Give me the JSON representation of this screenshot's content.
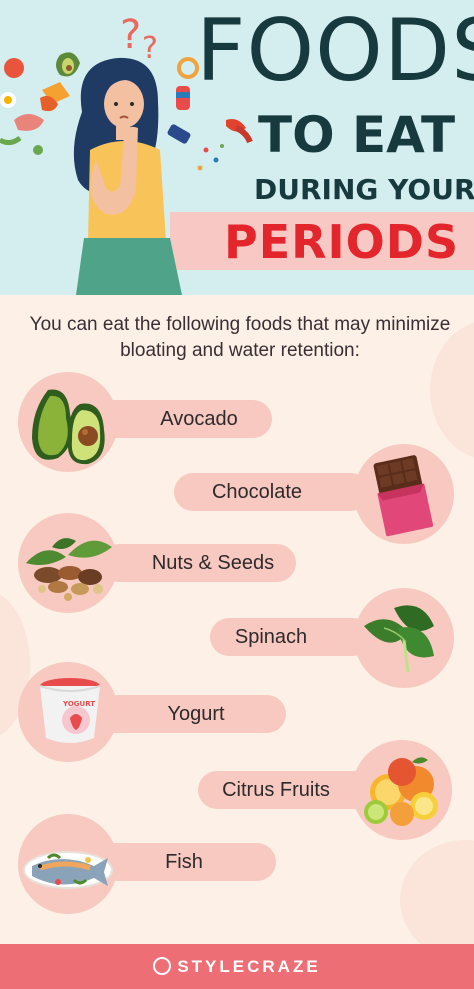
{
  "header": {
    "title_line1": "FOODS",
    "title_line2": "TO EAT",
    "title_line3": "DURING YOUR",
    "title_line4": "PERIODS"
  },
  "intro": "You can eat the following foods that may minimize bloating and water retention:",
  "foods": [
    {
      "label": "Avocado",
      "icon": "avocado-icon"
    },
    {
      "label": "Chocolate",
      "icon": "chocolate-icon"
    },
    {
      "label": "Nuts & Seeds",
      "icon": "nuts-icon"
    },
    {
      "label": "Spinach",
      "icon": "spinach-icon"
    },
    {
      "label": "Yogurt",
      "icon": "yogurt-icon"
    },
    {
      "label": "Citrus Fruits",
      "icon": "citrus-icon"
    },
    {
      "label": "Fish",
      "icon": "fish-icon"
    }
  ],
  "yogurt_cup_text": "YOGURT",
  "footer": {
    "brand": "STYLECRAZE"
  },
  "colors": {
    "header_bg": "#d4eef0",
    "title_dark": "#173a3f",
    "title_red": "#e3262c",
    "pill": "#f8c9c0",
    "footer": "#ee6e75",
    "page_bg": "#fdf1e7"
  }
}
